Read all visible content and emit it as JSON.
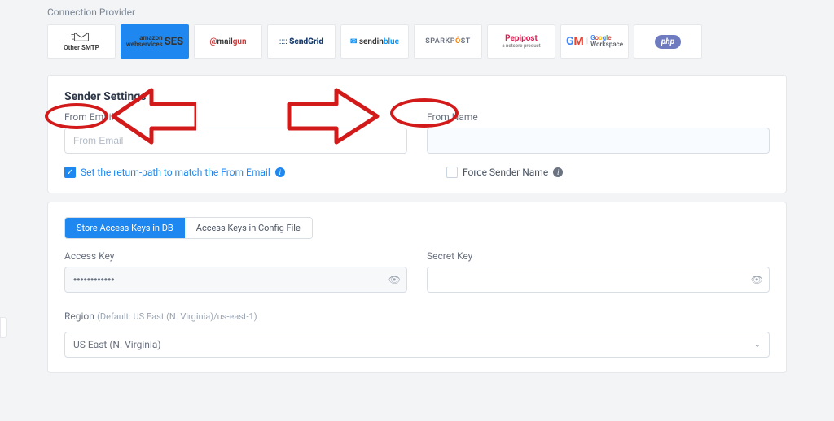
{
  "section_label": "Connection Provider",
  "providers": [
    {
      "id": "other-smtp",
      "label": "Other SMTP"
    },
    {
      "id": "amazon-ses",
      "label": "amazon webservices SES"
    },
    {
      "id": "mailgun",
      "label": "mailgun"
    },
    {
      "id": "sendgrid",
      "label": "SendGrid"
    },
    {
      "id": "sendinblue",
      "label": "sendinblue"
    },
    {
      "id": "sparkpost",
      "label": "SPARKPOST"
    },
    {
      "id": "pepipost",
      "label": "Pepipost",
      "tagline": "a netcore product"
    },
    {
      "id": "google-workspace",
      "label": "Google Workspace"
    },
    {
      "id": "php",
      "label": "php"
    }
  ],
  "selected_provider": "amazon-ses",
  "sender_settings": {
    "title": "Sender Settings",
    "from_email": {
      "label": "From Email",
      "placeholder": "From Email",
      "value": ""
    },
    "from_name": {
      "label": "From Name",
      "value": ""
    },
    "return_path_label": "Set the return-path to match the From Email",
    "return_path_checked": true,
    "force_sender_label": "Force Sender Name",
    "force_sender_checked": false
  },
  "keys": {
    "tab_db": "Store Access Keys in DB",
    "tab_file": "Access Keys in Config File",
    "active_tab": "db",
    "access_key": {
      "label": "Access Key",
      "value": "••••••••••••"
    },
    "secret_key": {
      "label": "Secret Key",
      "value": ""
    }
  },
  "region": {
    "label": "Region",
    "hint": "(Default: US East (N. Virginia)/us-east-1)",
    "selected": "US East (N. Virginia)"
  }
}
